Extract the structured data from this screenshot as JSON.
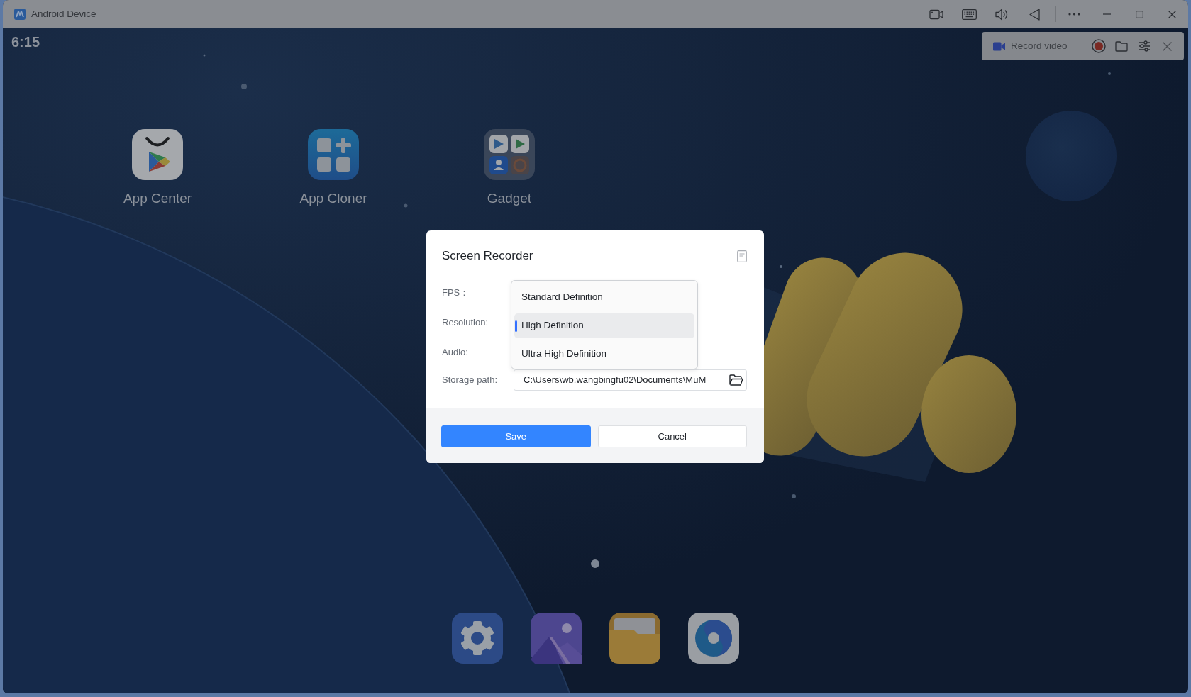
{
  "window": {
    "title": "Android Device"
  },
  "status_bar": {
    "time": "6:15"
  },
  "record_toolbar": {
    "label": "Record video"
  },
  "home_apps": [
    {
      "label": "App Center"
    },
    {
      "label": "App Cloner"
    },
    {
      "label": "Gadget"
    }
  ],
  "dialog": {
    "title": "Screen Recorder",
    "fields": [
      {
        "label": "FPS："
      },
      {
        "label": "Resolution:"
      },
      {
        "label": "Audio:"
      },
      {
        "label": "Storage path:",
        "value": "C:\\Users\\wb.wangbingfu02\\Documents\\MuM"
      }
    ],
    "dropdown": {
      "options": [
        {
          "label": "Standard Definition",
          "selected": false
        },
        {
          "label": "High Definition",
          "selected": true
        },
        {
          "label": "Ultra High Definition",
          "selected": false
        }
      ]
    },
    "buttons": [
      {
        "label": "Save",
        "kind": "primary"
      },
      {
        "label": "Cancel",
        "kind": "secondary"
      }
    ]
  }
}
